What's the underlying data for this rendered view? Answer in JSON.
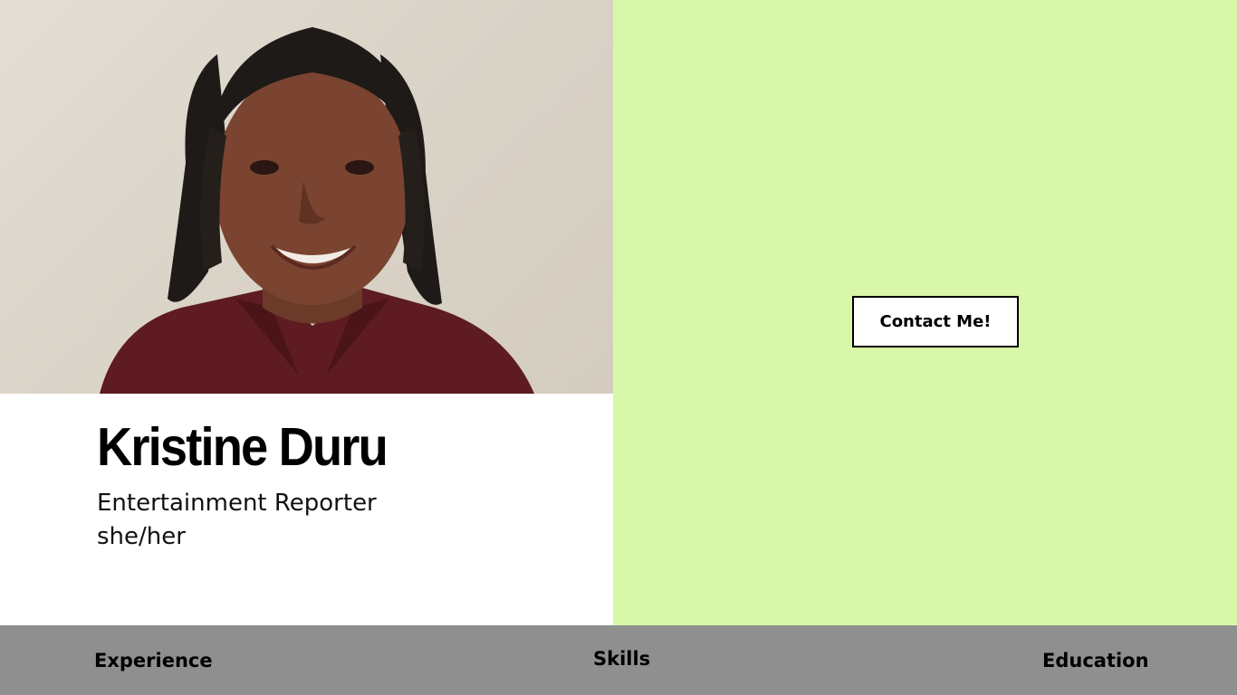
{
  "profile": {
    "name": "Kristine Duru",
    "role": "Entertainment Reporter",
    "pronouns": "she/her"
  },
  "contact": {
    "label": "Contact Me!"
  },
  "nav": {
    "items": [
      {
        "label": "Experience"
      },
      {
        "label": "Skills"
      },
      {
        "label": "Education"
      }
    ]
  },
  "colors": {
    "accent_green": "#d8f7a8",
    "nav_gray": "#8f8f8f",
    "button_border": "#000000"
  }
}
